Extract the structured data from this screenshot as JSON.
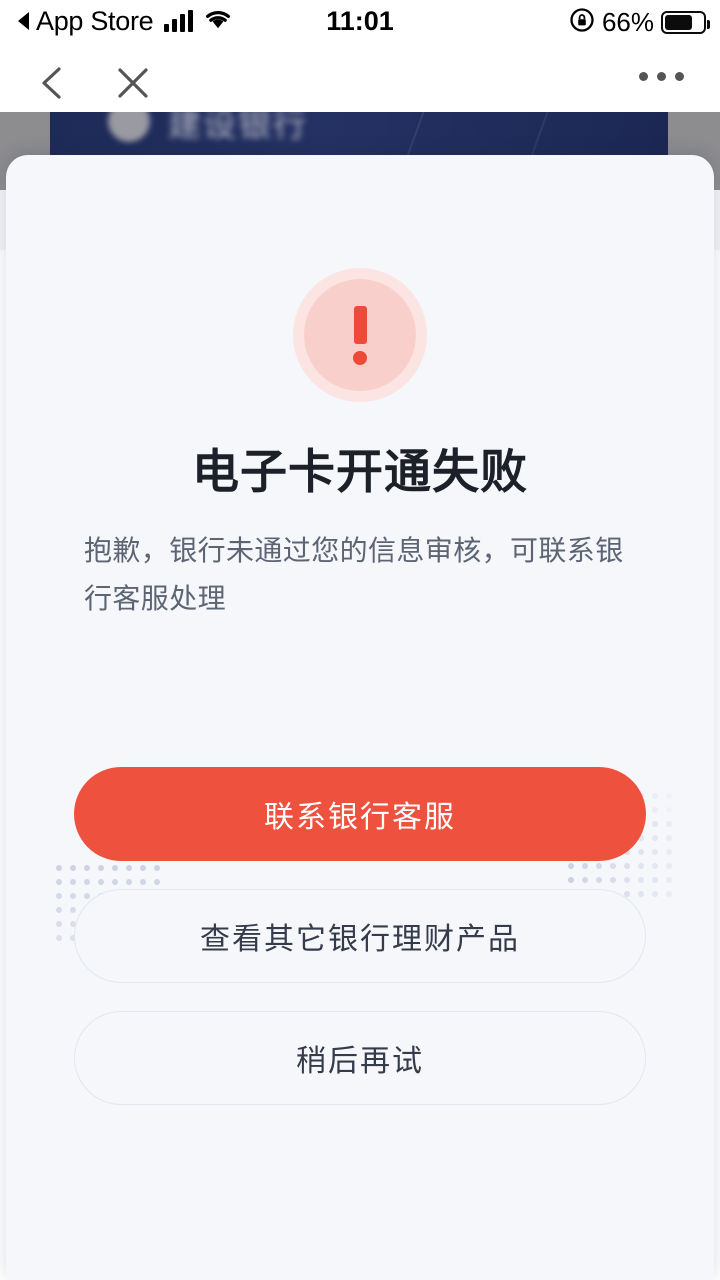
{
  "status_bar": {
    "back_app_label": "App Store",
    "time": "11:01",
    "battery_percent": "66%",
    "signal_icon": "cellular-signal-icon",
    "wifi_icon": "wifi-icon",
    "rotation_lock_icon": "rotation-lock-icon",
    "battery_icon": "battery-icon",
    "battery_level": 66
  },
  "nav_bar": {
    "back_icon": "chevron-left-icon",
    "close_icon": "close-x-icon",
    "more_icon": "more-horizontal-icon"
  },
  "background_page": {
    "bank_name": "建设银行",
    "banner_color": "#22305f",
    "logo_icon": "bank-logo-icon"
  },
  "modal": {
    "icon": {
      "name": "error-exclamation-icon",
      "outer_color": "#fbe4e2",
      "inner_color": "#f9cfcb",
      "mark_color": "#ef4a38"
    },
    "title": "电子卡开通失败",
    "description": "抱歉，银行未通过您的信息审核，可联系银行客服处理",
    "buttons": [
      {
        "label": "联系银行客服",
        "style": "primary",
        "color": "#ef513f"
      },
      {
        "label": "查看其它银行理财产品",
        "style": "outline",
        "color": "#343b4a"
      },
      {
        "label": "稍后再试",
        "style": "outline",
        "color": "#343b4a"
      }
    ],
    "decor": {
      "dot_color": "#cdd3e4",
      "left_grid": {
        "cols": 8,
        "rows": 6
      },
      "right_grid": {
        "cols": 8,
        "rows": 8
      }
    }
  }
}
